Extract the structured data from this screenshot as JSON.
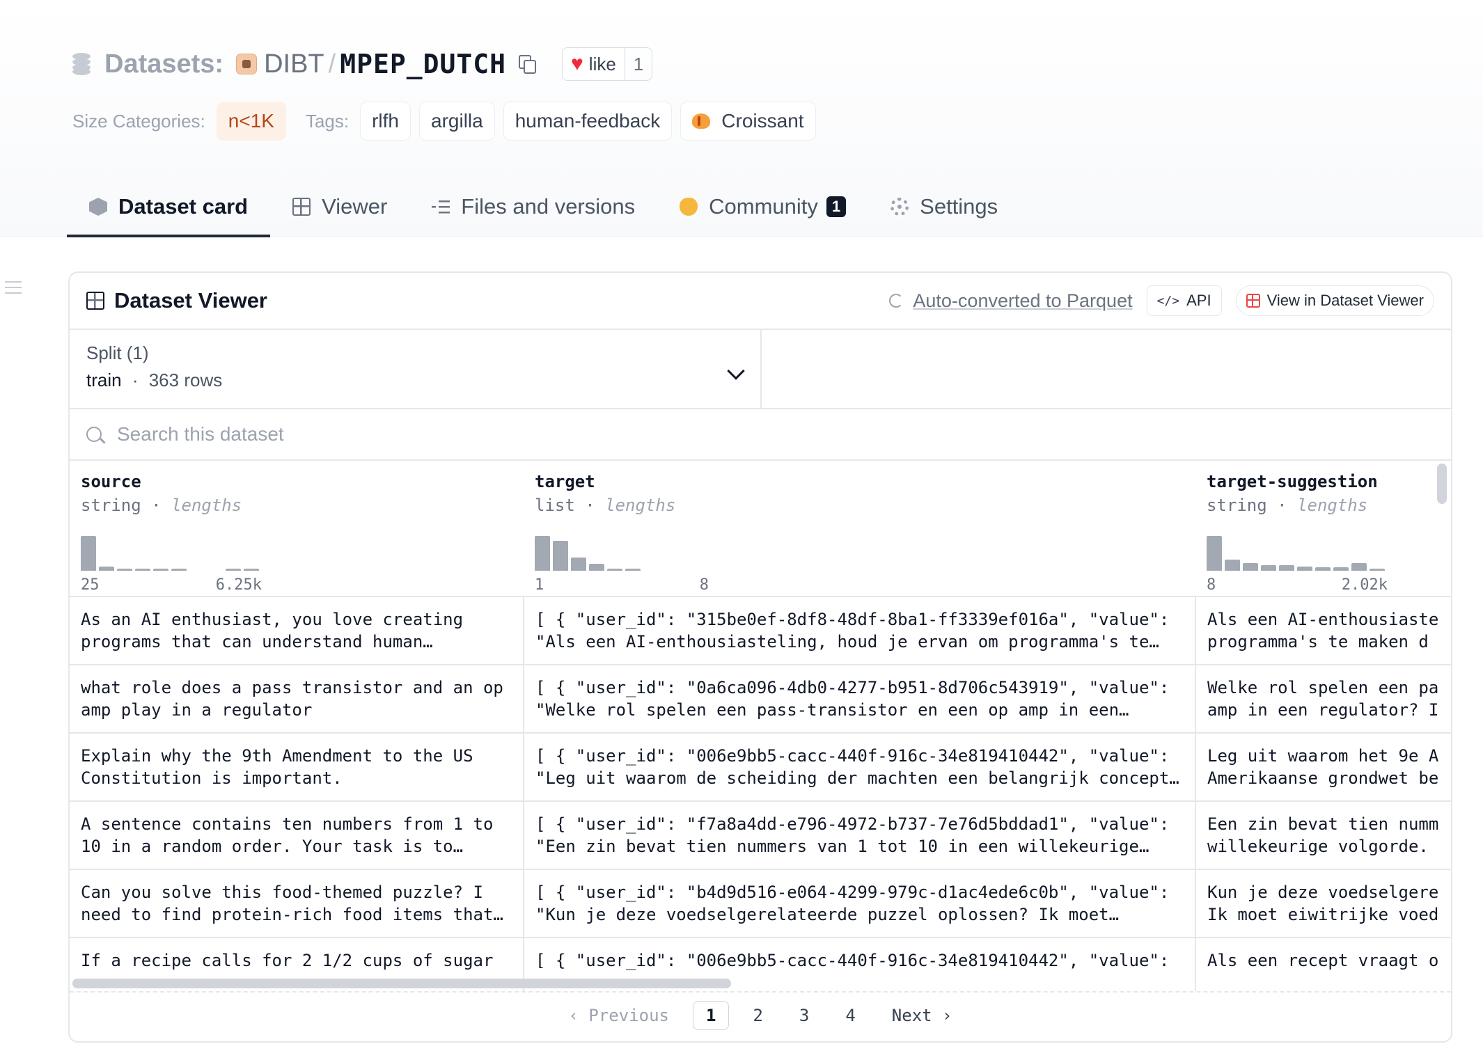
{
  "header": {
    "datasets_label": "Datasets:",
    "org": "DIBT",
    "separator": "/",
    "repo": "MPEP_DUTCH",
    "like_label": "like",
    "like_count": "1"
  },
  "tags": {
    "size_label": "Size Categories:",
    "size_value": "n<1K",
    "tags_label": "Tags:",
    "items": [
      "rlfh",
      "argilla",
      "human-feedback",
      "Croissant"
    ]
  },
  "tabs": [
    {
      "label": "Dataset card",
      "icon": "cube-icon"
    },
    {
      "label": "Viewer",
      "icon": "grid-icon"
    },
    {
      "label": "Files and versions",
      "icon": "files-icon"
    },
    {
      "label": "Community",
      "icon": "hand-icon",
      "badge": "1"
    },
    {
      "label": "Settings",
      "icon": "gear-icon"
    }
  ],
  "viewer": {
    "title": "Dataset Viewer",
    "parquet_label": "Auto-converted to Parquet",
    "api_label": "API",
    "view_label": "View in Dataset Viewer",
    "split_label": "Split (1)",
    "split_name": "train",
    "split_dot": "·",
    "split_rows": "363 rows",
    "search_placeholder": "Search this dataset"
  },
  "columns": [
    {
      "name": "source",
      "type": "string",
      "stat": "lengths",
      "min": "25",
      "max": "6.25k",
      "hist": [
        1.0,
        0.12,
        0.06,
        0.06,
        0.06,
        0.06,
        0,
        0,
        0.06,
        0.06
      ]
    },
    {
      "name": "target",
      "type": "list",
      "stat": "lengths",
      "min": "1",
      "max": "8",
      "hist": [
        1.0,
        0.85,
        0.38,
        0.2,
        0.06,
        0.06,
        0,
        0
      ]
    },
    {
      "name": "target-suggestion",
      "type": "string",
      "stat": "lengths",
      "min": "8",
      "max": "2.02k",
      "hist": [
        1.0,
        0.32,
        0.22,
        0.16,
        0.16,
        0.12,
        0.1,
        0.1,
        0.22,
        0.06
      ]
    }
  ],
  "rows": [
    {
      "source": [
        "As an AI enthusiast, you love creating",
        "programs that can understand human…"
      ],
      "target": [
        "[ { \"user_id\": \"315be0ef-8df8-48df-8ba1-ff3339ef016a\", \"value\":",
        "\"Als een AI-enthousiasteling, houd je ervan om programma's te…"
      ],
      "suggestion": [
        "Als een AI-enthousiaste",
        "programma's te maken d"
      ]
    },
    {
      "source": [
        "what role does a pass transistor and an op",
        "amp play in a regulator"
      ],
      "target": [
        "[ { \"user_id\": \"0a6ca096-4db0-4277-b951-8d706c543919\", \"value\":",
        "\"Welke rol spelen een pass-transistor en een op amp in een…"
      ],
      "suggestion": [
        "Welke rol spelen een pa",
        "amp in een regulator? I"
      ]
    },
    {
      "source": [
        "Explain why the 9th Amendment to the US",
        "Constitution is important."
      ],
      "target": [
        "[ { \"user_id\": \"006e9bb5-cacc-440f-916c-34e819410442\", \"value\":",
        "\"Leg uit waarom de scheiding der machten een belangrijk concept…"
      ],
      "suggestion": [
        "Leg uit waarom het 9e A",
        "Amerikaanse grondwet be"
      ]
    },
    {
      "source": [
        "A sentence contains ten numbers from 1 to",
        "10 in a random order. Your task is to…"
      ],
      "target": [
        "[ { \"user_id\": \"f7a8a4dd-e796-4972-b737-7e76d5bddad1\", \"value\":",
        "\"Een zin bevat tien nummers van 1 tot 10 in een willekeurige…"
      ],
      "suggestion": [
        "Een zin bevat tien numm",
        "willekeurige volgorde."
      ]
    },
    {
      "source": [
        "Can you solve this food-themed puzzle? I",
        "need to find protein-rich food items that…"
      ],
      "target": [
        "[ { \"user_id\": \"b4d9d516-e064-4299-979c-d1ac4ede6c0b\", \"value\":",
        "\"Kun je deze voedselgerelateerde puzzel oplossen? Ik moet…"
      ],
      "suggestion": [
        "Kun je deze voedselgere",
        "Ik moet eiwitrijke voed"
      ]
    },
    {
      "source": [
        "If a recipe calls for 2 1/2 cups of sugar",
        ""
      ],
      "target": [
        "[ { \"user_id\": \"006e9bb5-cacc-440f-916c-34e819410442\", \"value\":",
        ""
      ],
      "suggestion": [
        "Als een recept vraagt o",
        ""
      ]
    }
  ],
  "pagination": {
    "prev": "Previous",
    "pages": [
      "1",
      "2",
      "3",
      "4"
    ],
    "current": "1",
    "next": "Next"
  }
}
